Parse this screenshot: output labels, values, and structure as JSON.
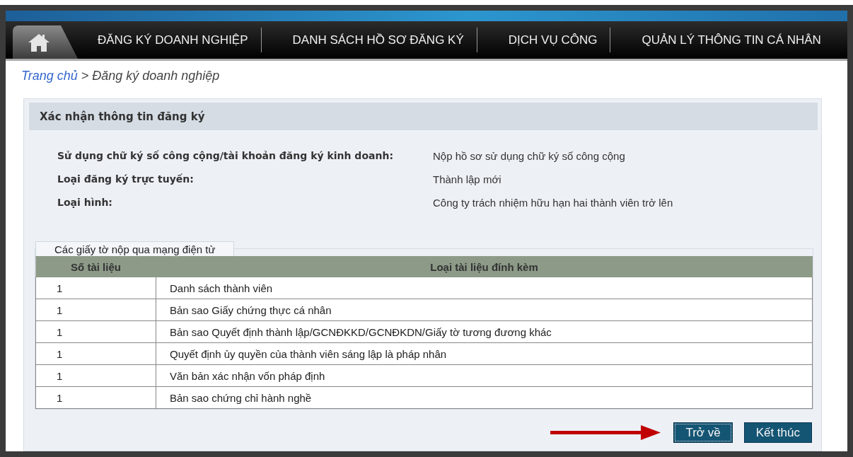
{
  "nav": {
    "home_tab": {
      "selected": true
    },
    "items": [
      {
        "label": "ĐĂNG KÝ DOANH NGHIỆP",
        "selected": false
      },
      {
        "label": "DANH SÁCH HỒ SƠ ĐĂNG KÝ",
        "selected": false
      },
      {
        "label": "DỊCH VỤ CÔNG",
        "selected": false
      },
      {
        "label": "QUẢN LÝ THÔNG TIN CÁ NHÂN",
        "selected": false
      }
    ]
  },
  "breadcrumb": {
    "link": "Trang chủ",
    "separator": ">",
    "current": "Đăng ký doanh nghiệp"
  },
  "panel": {
    "title": "Xác nhận thông tin đăng ký",
    "fields": [
      {
        "label": "Sử dụng chữ ký số công cộng/tài khoản đăng ký kinh doanh:",
        "value": "Nộp hồ sơ sử dụng chữ ký số công cộng"
      },
      {
        "label": "Loại đăng ký trực tuyến:",
        "value": "Thành lập mới"
      },
      {
        "label": "Loại hình:",
        "value": "Công ty trách nhiệm hữu hạn hai thành viên trở lên"
      }
    ],
    "documents": {
      "legend": "Các giấy tờ nộp qua mạng điện tử",
      "columns": [
        "Số tài liệu",
        "Loại tài liệu đính kèm"
      ],
      "rows": [
        [
          "1",
          "Danh sách thành viên"
        ],
        [
          "1",
          "Bản sao Giấy chứng thực cá nhân"
        ],
        [
          "1",
          "Bản sao Quyết định thành lập/GCNĐKKD/GCNĐKDN/Giấy tờ tương đương khác"
        ],
        [
          "1",
          "Quyết định ủy quyền của thành viên sáng lập là pháp nhân"
        ],
        [
          "1",
          "Văn bản xác nhận vốn pháp định"
        ],
        [
          "1",
          "Bản sao chứng chỉ hành nghề"
        ]
      ]
    },
    "buttons": [
      {
        "label": "Trở về",
        "focused": true
      },
      {
        "label": "Kết thúc",
        "focused": false
      }
    ]
  }
}
